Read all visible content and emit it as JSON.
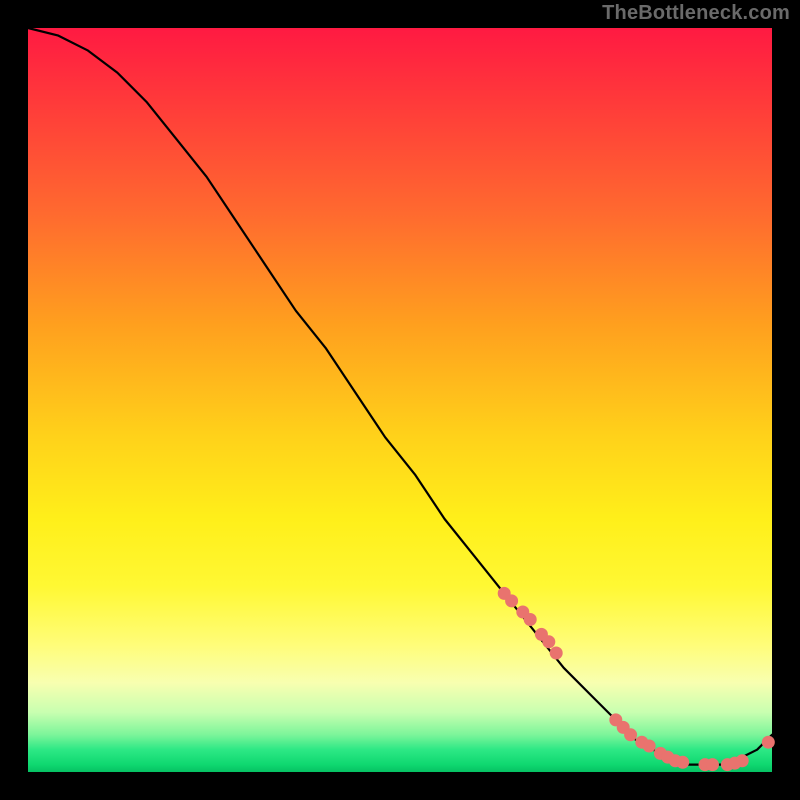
{
  "watermark": "TheBottleneck.com",
  "colors": {
    "background": "#000000",
    "curve": "#000000",
    "marker": "#e9736e",
    "gradient_top": "#ff1a42",
    "gradient_bottom": "#06c163"
  },
  "chart_data": {
    "type": "line",
    "title": "",
    "xlabel": "",
    "ylabel": "",
    "xlim": [
      0,
      100
    ],
    "ylim": [
      0,
      100
    ],
    "series": [
      {
        "name": "bottleneck-curve",
        "x": [
          0,
          4,
          8,
          12,
          16,
          20,
          24,
          28,
          32,
          36,
          40,
          44,
          48,
          52,
          56,
          60,
          64,
          68,
          72,
          76,
          80,
          82,
          84,
          86,
          88,
          90,
          92,
          94,
          96,
          98,
          100
        ],
        "y": [
          100,
          99,
          97,
          94,
          90,
          85,
          80,
          74,
          68,
          62,
          57,
          51,
          45,
          40,
          34,
          29,
          24,
          19,
          14,
          10,
          6,
          4,
          3,
          2,
          1,
          1,
          1,
          1,
          2,
          3,
          5
        ]
      }
    ],
    "markers": {
      "name": "highlighted-points",
      "x": [
        64,
        65,
        66.5,
        67.5,
        69,
        70,
        71,
        79,
        80,
        81,
        82.5,
        83.5,
        85,
        86,
        87,
        88,
        91,
        92,
        94,
        95,
        96,
        99.5
      ],
      "y": [
        24,
        23,
        21.5,
        20.5,
        18.5,
        17.5,
        16,
        7,
        6,
        5,
        4,
        3.5,
        2.5,
        2,
        1.5,
        1.3,
        1,
        1,
        1,
        1.2,
        1.5,
        4
      ]
    }
  }
}
